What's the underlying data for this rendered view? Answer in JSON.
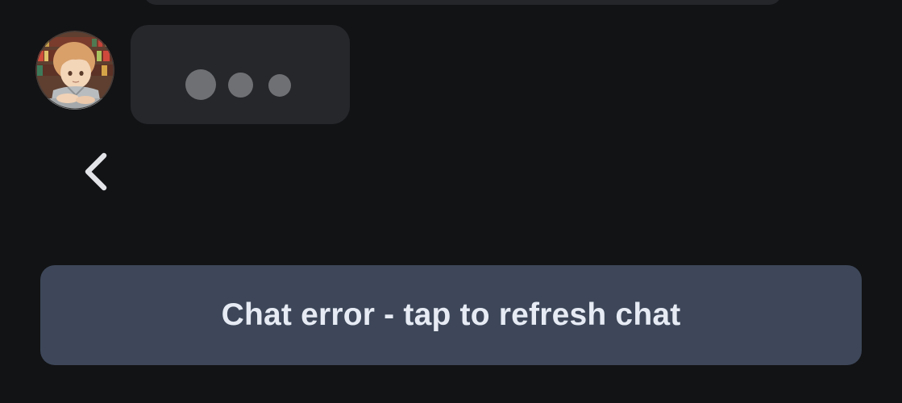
{
  "chat": {
    "avatar_icon": "character-avatar-icon",
    "typing_indicator_icon": "typing-dots-icon",
    "back_icon": "chevron-left-icon",
    "error_label": "Chat error - tap to refresh chat"
  },
  "colors": {
    "background": "#121315",
    "bubble": "#25272b",
    "typing_dot": "#6e7074",
    "error_button": "#3d4759",
    "error_text": "#e6ebf4"
  }
}
